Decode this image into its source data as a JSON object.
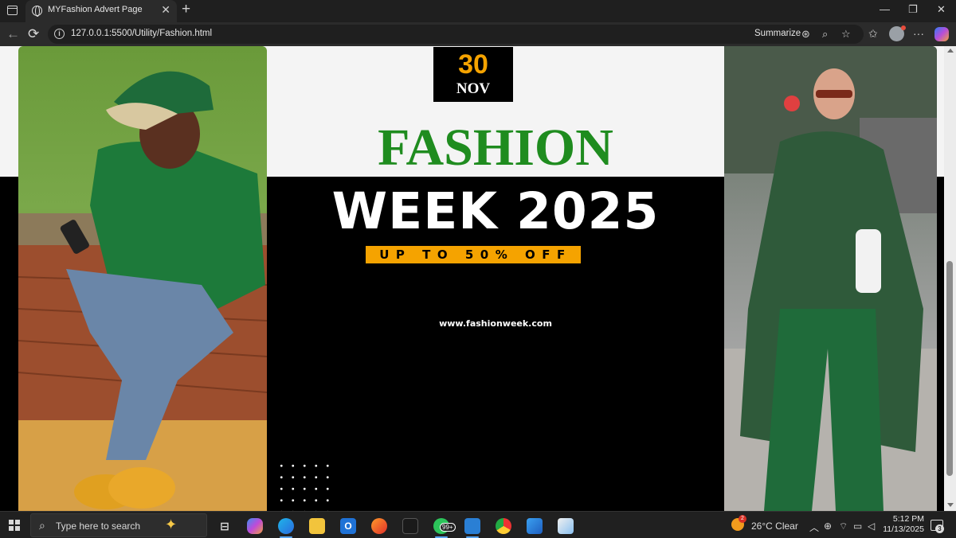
{
  "browser": {
    "tab_title": "MYFashion Advert Page",
    "url": "127.0.0.1:5500/Utility/Fashion.html",
    "summarize_label": "Summarize",
    "close_tab_glyph": "✕",
    "new_tab_glyph": "+",
    "back_glyph": "←",
    "reload_glyph": "⟳",
    "info_glyph": "i",
    "minimize_glyph": "—",
    "maximize_glyph": "❐",
    "close_window_glyph": "✕",
    "more_glyph": "···",
    "icons": [
      "window-icon",
      "globe-icon",
      "info-icon",
      "reader-icon",
      "zoom-icon",
      "favorite-star-icon",
      "favorites-icon",
      "profile-avatar-icon",
      "menu-icon",
      "copilot-icon"
    ]
  },
  "ad": {
    "date_day": "30",
    "date_month": "NOV",
    "headline_top": "FASHION",
    "headline_bottom": "WEEK 2025",
    "offer": "UP TO 50% OFF",
    "website": "www.fashionweek.com",
    "colors": {
      "accent_orange": "#f5a300",
      "accent_green": "#1f8c1f",
      "band_light": "#f4f4f4",
      "band_dark": "#000000"
    }
  },
  "taskbar": {
    "search_placeholder": "Type here to search",
    "whatsapp_badge": "99+",
    "weather_badge": "2",
    "weather_text": "26°C  Clear",
    "time": "5:12 PM",
    "date": "11/13/2025",
    "notification_count": "3",
    "apps": [
      "task-view-icon",
      "copilot-app-icon",
      "edge-icon",
      "file-explorer-icon",
      "outlook-icon",
      "firefox-icon",
      "figma-icon",
      "whatsapp-icon",
      "vscode-icon",
      "chrome-icon",
      "photos-icon",
      "paint-icon"
    ]
  }
}
